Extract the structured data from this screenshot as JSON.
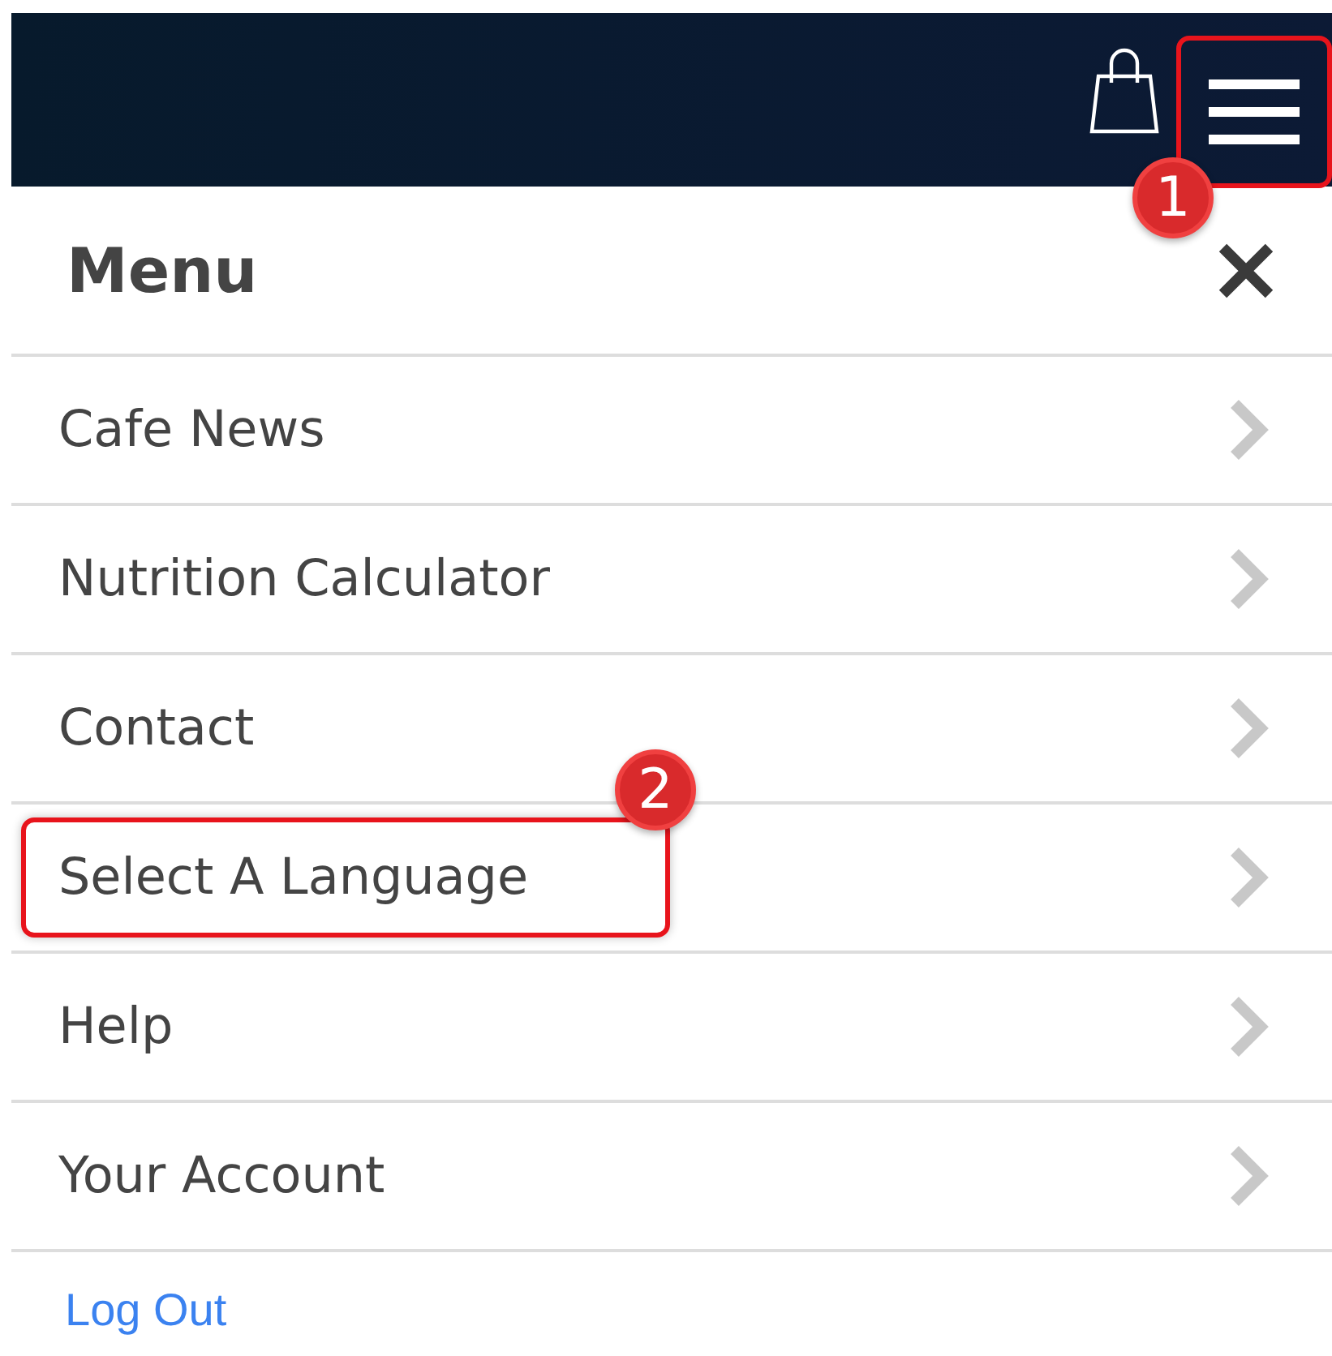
{
  "header": {
    "menu_button": {
      "highlighted": true,
      "callout": "1"
    }
  },
  "menu": {
    "title": "Menu",
    "items": [
      {
        "label": "Cafe News",
        "highlighted": false
      },
      {
        "label": "Nutrition Calculator",
        "highlighted": false
      },
      {
        "label": "Contact",
        "highlighted": false
      },
      {
        "label": "Select A Language",
        "highlighted": true,
        "callout": "2"
      },
      {
        "label": "Help",
        "highlighted": false
      },
      {
        "label": "Your Account",
        "highlighted": false
      }
    ],
    "footer_link": "Log Out"
  }
}
